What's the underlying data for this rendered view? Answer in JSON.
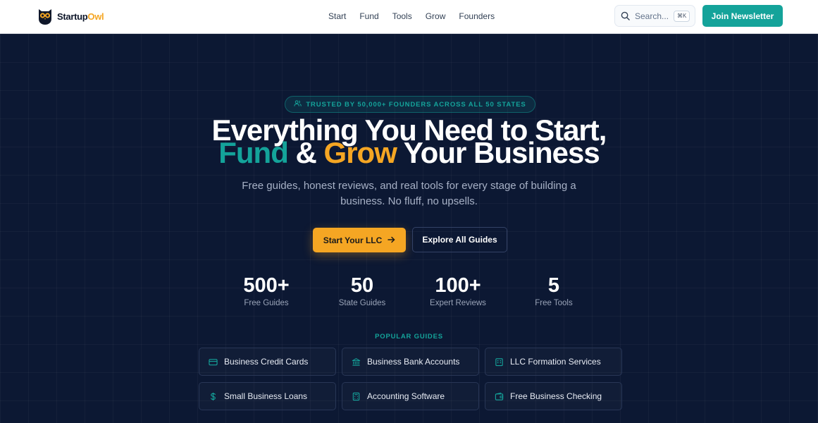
{
  "brand": {
    "name_part1": "Startup",
    "name_part2": "Owl"
  },
  "nav": {
    "items": [
      "Start",
      "Fund",
      "Tools",
      "Grow",
      "Founders"
    ]
  },
  "search": {
    "placeholder": "Search...",
    "shortcut": "⌘K"
  },
  "header": {
    "cta_label": "Join Newsletter"
  },
  "hero": {
    "badge": "TRUSTED BY 50,000+ FOUNDERS ACROSS ALL 50 STATES",
    "headline_line1": "Everything You Need to Start,",
    "headline_fund": "Fund",
    "headline_amp": " & ",
    "headline_grow": "Grow",
    "headline_rest": " Your Business",
    "subtitle": "Free guides, honest reviews, and real tools for every stage of building a business. No fluff, no upsells.",
    "primary_cta": "Start Your LLC",
    "secondary_cta": "Explore All Guides"
  },
  "stats": [
    {
      "value": "500+",
      "label": "Free Guides"
    },
    {
      "value": "50",
      "label": "State Guides"
    },
    {
      "value": "100+",
      "label": "Expert Reviews"
    },
    {
      "value": "5",
      "label": "Free Tools"
    }
  ],
  "popular": {
    "title": "POPULAR GUIDES",
    "items": [
      {
        "label": "Business Credit Cards",
        "icon": "credit-card-icon"
      },
      {
        "label": "Business Bank Accounts",
        "icon": "bank-icon"
      },
      {
        "label": "LLC Formation Services",
        "icon": "building-icon"
      },
      {
        "label": "Small Business Loans",
        "icon": "dollar-icon"
      },
      {
        "label": "Accounting Software",
        "icon": "calculator-icon"
      },
      {
        "label": "Free Business Checking",
        "icon": "wallet-icon"
      }
    ]
  },
  "colors": {
    "teal": "#14a39a",
    "gold": "#f5a623",
    "navy": "#0c1833"
  }
}
